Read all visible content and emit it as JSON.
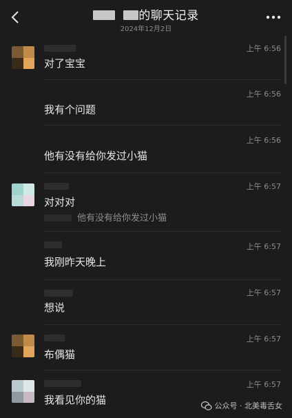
{
  "header": {
    "title_suffix": "的聊天记录",
    "date": "2024年12月2日"
  },
  "messages": [
    {
      "time": "上午 6:56",
      "text": "对了宝宝",
      "avatar": "a"
    },
    {
      "time": "上午 6:56",
      "text": "我有个问题"
    },
    {
      "time": "上午 6:56",
      "text": "他有没有给你发过小猫"
    },
    {
      "time": "上午 6:57",
      "text": "对对对",
      "avatar": "b",
      "quote": "他有没有给你发过小猫"
    },
    {
      "time": "上午 6:57",
      "text": "我刚昨天晚上"
    },
    {
      "time": "上午 6:57",
      "text": "想说"
    },
    {
      "time": "上午 6:57",
      "text": "布偶猫",
      "avatar": "a"
    },
    {
      "time": "上午 6:57",
      "text": "我看见你的猫",
      "avatar": "b"
    }
  ],
  "watermark": {
    "text": "公众号 · 北美毒舌女",
    "icon": "wechat-icon"
  },
  "colors": {
    "background": "#1c1c1c",
    "text": "#e6e6e6",
    "time": "#8d8d8d"
  }
}
